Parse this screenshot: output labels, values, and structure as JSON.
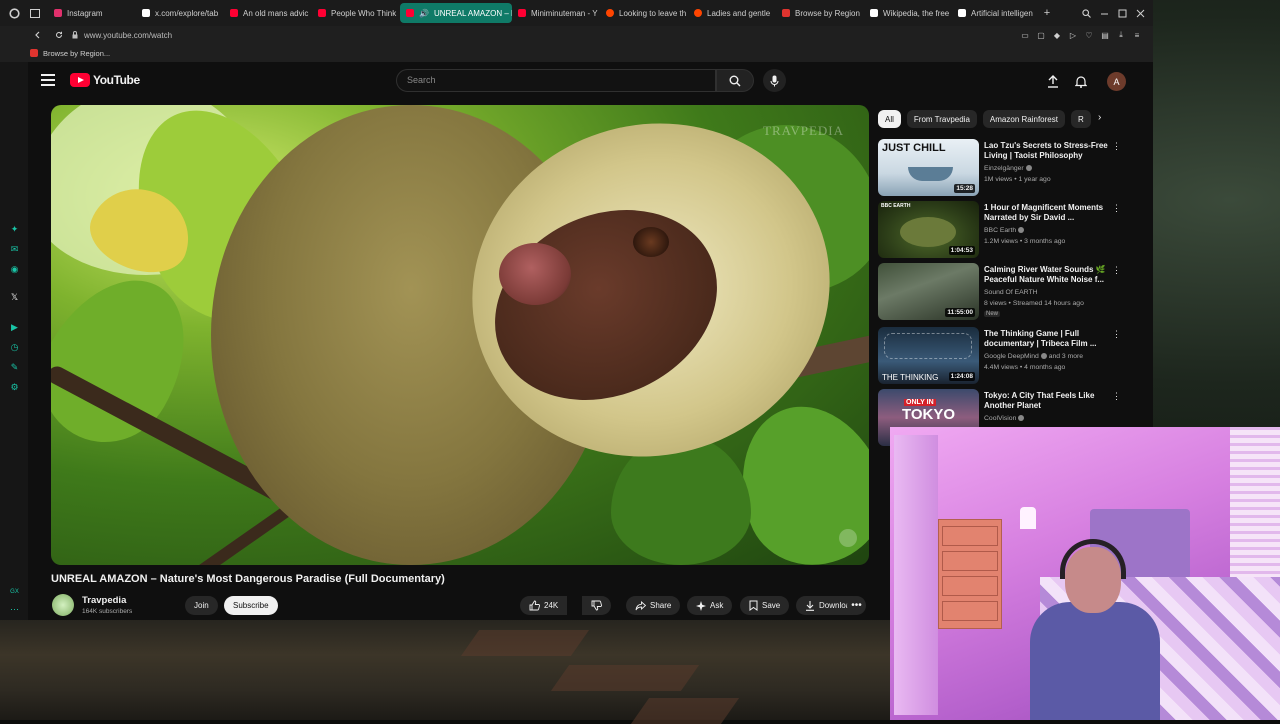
{
  "browser": {
    "tabs": [
      {
        "label": "Instagram",
        "color": "#e1306c"
      },
      {
        "label": "x.com/explore/tab",
        "color": "#ffffff"
      },
      {
        "label": "An old mans advic",
        "color": "#ff0033"
      },
      {
        "label": "People Who Think",
        "color": "#ff0033"
      },
      {
        "label": "UNREAL AMAZON – N",
        "color": "#ff0033",
        "active": true
      },
      {
        "label": "Miniminuteman - Y",
        "color": "#ff0033"
      },
      {
        "label": "Looking to leave th",
        "color": "#ff4500"
      },
      {
        "label": "Ladies and gentle",
        "color": "#ff4500"
      },
      {
        "label": "Browse by Region",
        "color": "#e0342f"
      },
      {
        "label": "Wikipedia, the free",
        "color": "#ffffff"
      },
      {
        "label": "Artificial intelligen",
        "color": "#ffffff"
      }
    ],
    "new_tab": "+",
    "url": "www.youtube.com/watch",
    "bookmark": "Browse by Region...",
    "accent": "#0f7a67"
  },
  "youtube": {
    "logo_text": "YouTube",
    "search_placeholder": "Search",
    "avatar_letter": "A",
    "video": {
      "watermark": "TRAVPEDIA",
      "title": "UNREAL AMAZON – Nature's Most Dangerous Paradise (Full Documentary)",
      "channel": "Travpedia",
      "subscribers": "164K subscribers",
      "join_label": "Join",
      "subscribe_label": "Subscribe",
      "likes": "24K",
      "share_label": "Share",
      "ask_label": "Ask",
      "save_label": "Save",
      "download_label": "Download"
    },
    "chips": [
      "All",
      "From Travpedia",
      "Amazon Rainforest",
      "R"
    ],
    "recommendations": [
      {
        "title": "Lao Tzu's Secrets to Stress-Free Living | Taoist Philosophy",
        "channel": "Einzelgänger",
        "meta": "1M views • 1 year ago",
        "duration": "15:28",
        "thumb_text": "JUST CHILL"
      },
      {
        "title": "1 Hour of Magnificent Moments Narrated by Sir David ...",
        "channel": "BBC Earth",
        "meta": "1.2M views • 3 months ago",
        "duration": "1:04:53",
        "thumb_text": "BBC EARTH"
      },
      {
        "title": "Calming River Water Sounds 🌿 Peaceful Nature White Noise f...",
        "channel": "Sound Of EARTH",
        "meta": "8 views • Streamed 14 hours ago",
        "duration": "11:55:00",
        "badge": "New"
      },
      {
        "title": "The Thinking Game | Full documentary | Tribeca Film ...",
        "channel": "Google DeepMind",
        "channel_extra": "and 3 more",
        "meta": "4.4M views • 4 months ago",
        "duration": "1:24:08",
        "thumb_text": "THE THINKING"
      },
      {
        "title": "Tokyo: A City That Feels Like Another Planet",
        "channel": "CoolVision",
        "meta": "",
        "duration": "",
        "thumb_text": "TOKYO",
        "thumb_text_top": "ONLY IN"
      }
    ]
  }
}
